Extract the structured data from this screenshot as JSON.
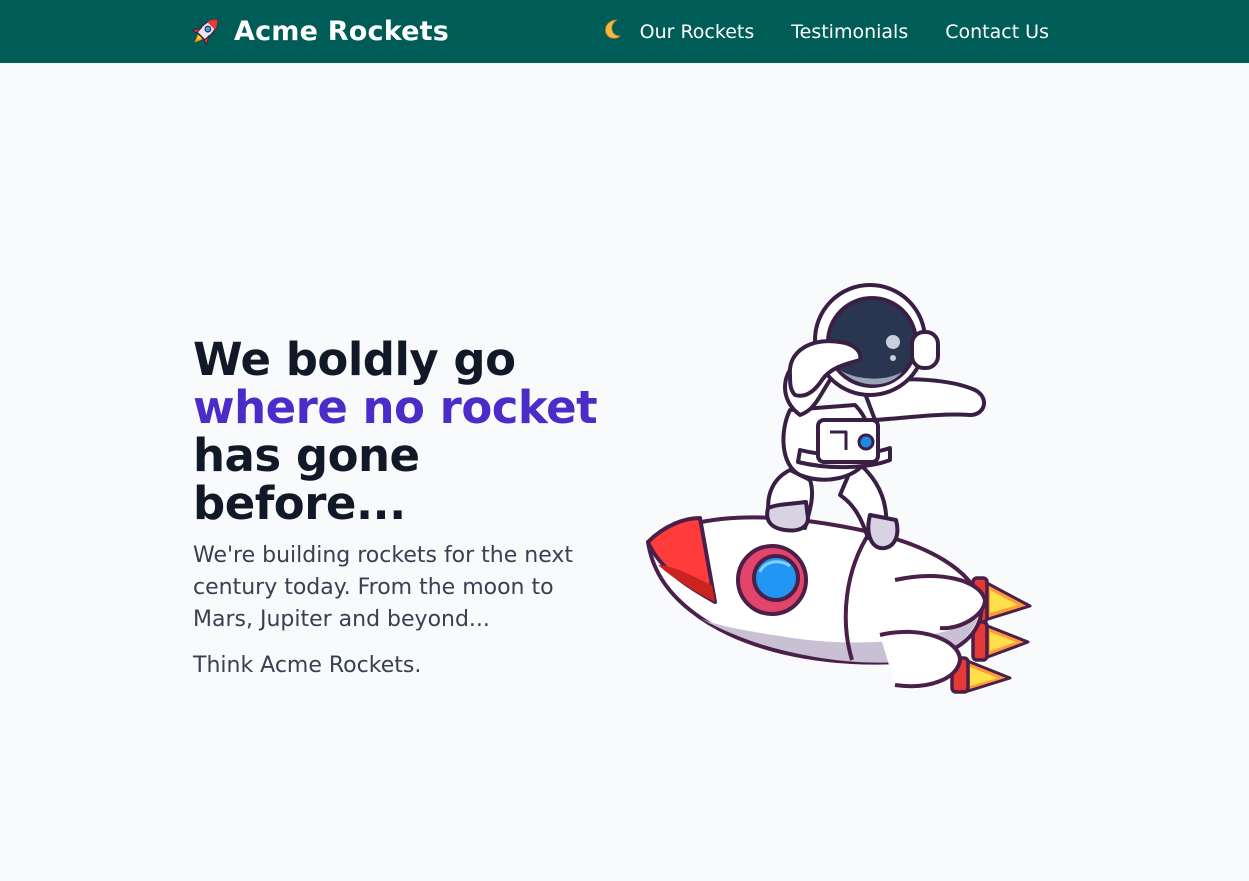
{
  "navbar": {
    "brand": "Acme Rockets",
    "theme_toggle_icon": "moon-icon",
    "links": [
      {
        "label": "Our Rockets"
      },
      {
        "label": "Testimonials"
      },
      {
        "label": "Contact Us"
      }
    ]
  },
  "hero": {
    "title_line1": "We boldly go",
    "title_line2": "where no rocket",
    "title_line3": "has gone before...",
    "description": "We're building rockets for the next century today. From the moon to Mars, Jupiter and beyond...",
    "tagline": "Think Acme Rockets.",
    "illustration": "astronaut-on-rocket-illustration"
  },
  "colors": {
    "nav_bg": "#005c56",
    "accent": "#4c2cc8",
    "page_bg": "#f8fafc"
  }
}
